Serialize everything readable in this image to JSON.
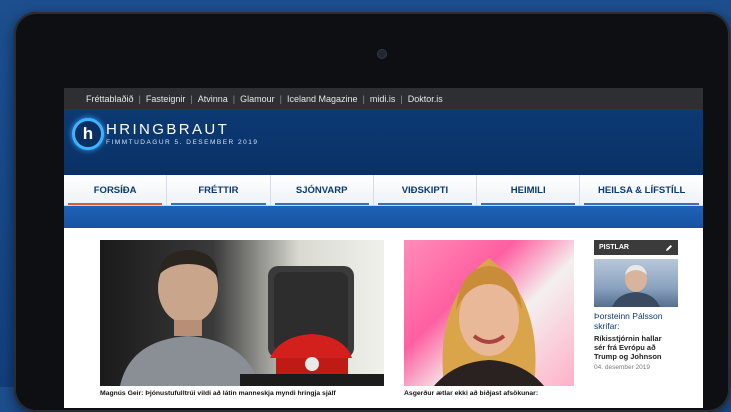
{
  "topbar": {
    "links": [
      "Fréttablaðið",
      "Fasteignir",
      "Atvinna",
      "Glamour",
      "Iceland Magazine",
      "midi.is",
      "Doktor.is"
    ],
    "separator": "|"
  },
  "header": {
    "logo_letter": "h",
    "brand": "HRINGBRAUT",
    "date": "FIMMTUDAGUR 5. DESEMBER 2019"
  },
  "nav": {
    "items": [
      "FORSÍÐA",
      "FRÉTTIR",
      "SJÓNVARP",
      "VIÐSKIPTI",
      "HEIMILI",
      "HEILSA & LÍFSTÍLL"
    ],
    "active_index": 0,
    "active_color": "#e0582f",
    "accent_color": "#3c6fb3"
  },
  "articles": [
    {
      "caption": "Magnús Geir: Þjónustufulltrúi vildi að látin manneskja myndi hringja sjálf"
    },
    {
      "caption": "Ásgerður ætlar ekki að biðjast afsökunar:"
    }
  ],
  "sidebar": {
    "header": "PISTLAR",
    "edit_icon": "pencil-icon",
    "author_line1": "Þorsteinn Pálsson",
    "author_line2": "skrifar:",
    "title_line1": "Ríkisstjórnin hallar",
    "title_line2": "sér frá Evrópu að",
    "title_line3": "Trump og Johnson",
    "date": "04. desember 2019"
  },
  "colors": {
    "header_bg": "#0c3a74",
    "topbar_bg": "#2d2f33",
    "strip_bg": "#1e62b7"
  }
}
